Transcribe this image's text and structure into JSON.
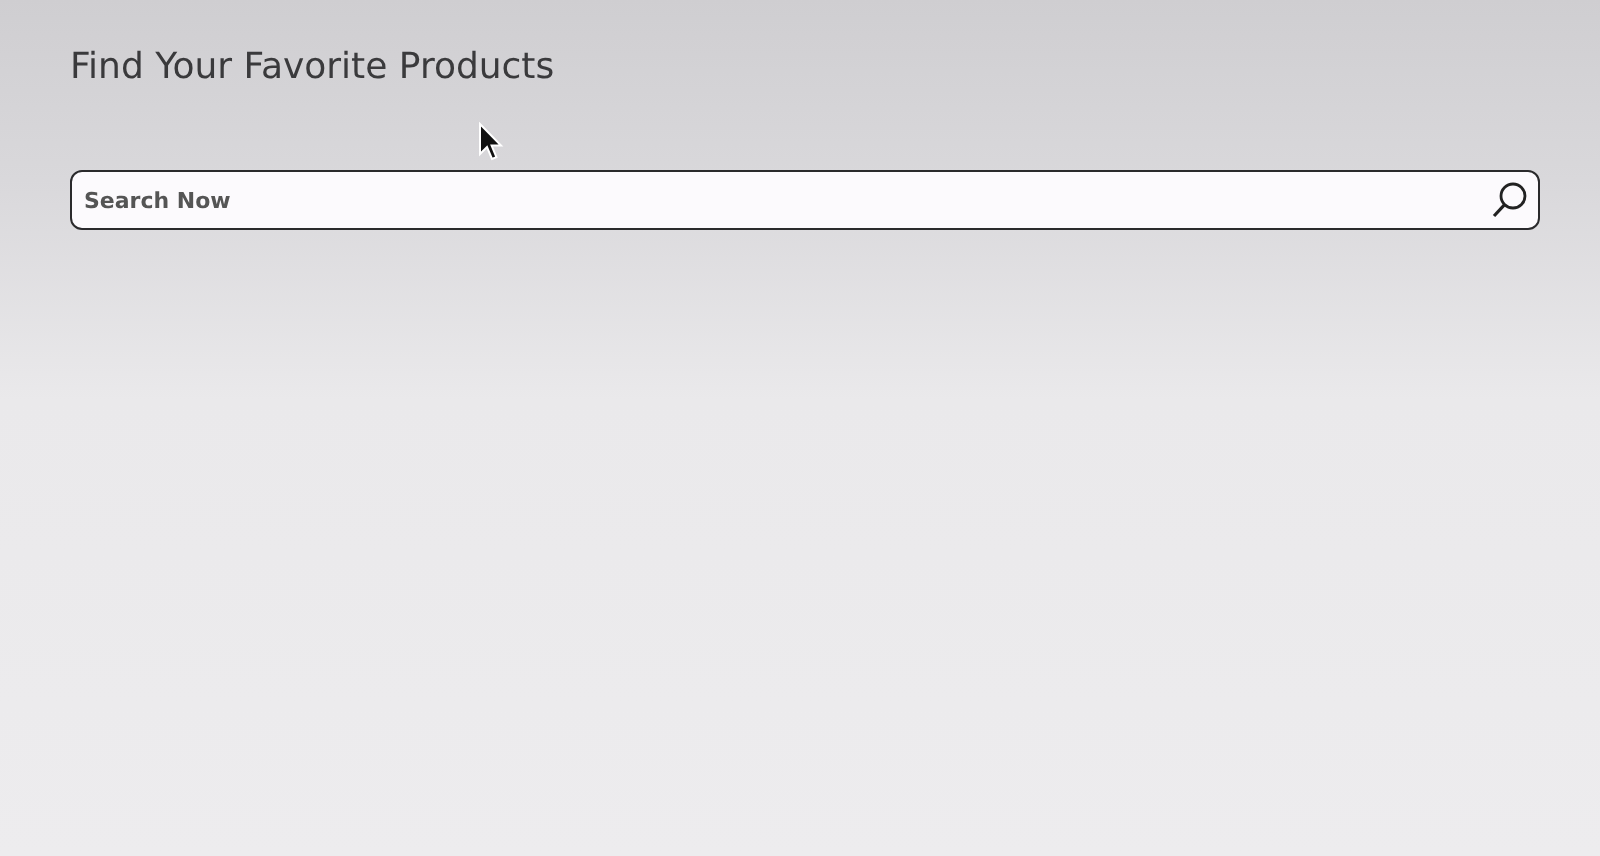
{
  "heading": "Find Your Favorite Products",
  "search": {
    "placeholder": "Search Now"
  }
}
